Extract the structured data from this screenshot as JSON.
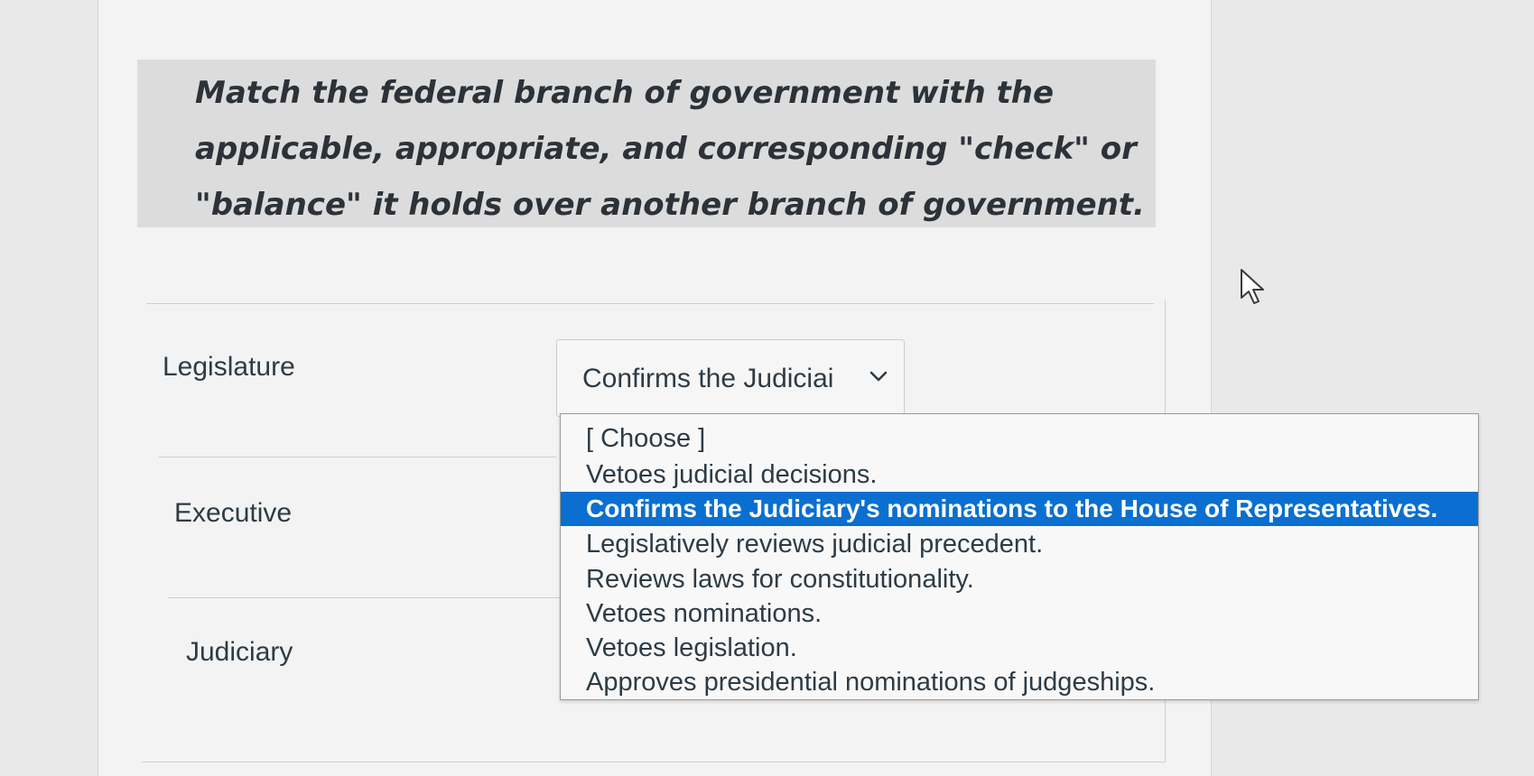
{
  "question": {
    "text": "Match the federal branch of government with the applicable, appropriate, and corresponding \"check\" or \"balance\" it holds over another branch of government."
  },
  "rows": [
    {
      "label": "Legislature"
    },
    {
      "label": "Executive"
    },
    {
      "label": "Judiciary"
    }
  ],
  "select": {
    "value": "Confirms the Judiciai",
    "icon": "chevron-down-icon"
  },
  "dropdown": {
    "options": [
      "[ Choose ]",
      "Vetoes judicial decisions.",
      "Confirms the Judiciary's nominations to the House of Representatives.",
      "Legislatively reviews judicial precedent.",
      "Reviews laws for constitutionality.",
      "Vetoes nominations.",
      "Vetoes legislation.",
      "Approves presidential nominations of judgeships."
    ],
    "selected_index": 2,
    "highlight_color": "#0a6fd0"
  },
  "cursor": {
    "icon": "pointer-cursor-icon"
  }
}
